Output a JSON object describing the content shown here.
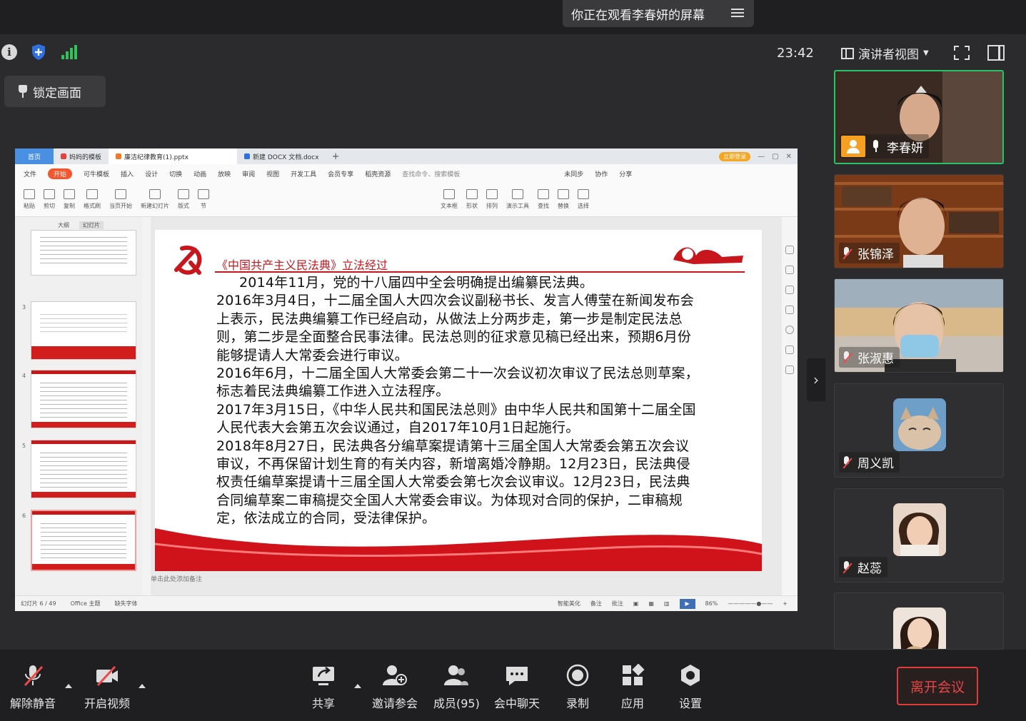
{
  "banner": {
    "share_status": "你正在观看李春妍的屏幕"
  },
  "status_bar": {
    "time": "23:42",
    "view_label": "演讲者视图"
  },
  "lock_button": {
    "label": "锁定画面"
  },
  "wps": {
    "tabs": [
      {
        "label": "首页"
      },
      {
        "label": "妈妈的模板"
      },
      {
        "label": "廉洁纪律教育(1).pptx"
      },
      {
        "label": "新建 DOCX 文档.docx"
      }
    ],
    "upgrade_badge": "立即登录",
    "menu": [
      "文件",
      "开始",
      "可牛模板",
      "插入",
      "设计",
      "切换",
      "动画",
      "放映",
      "审阅",
      "视图",
      "开发工具",
      "会员专享",
      "稻壳资源",
      "查找命令、搜索模板",
      "未同步",
      "协作",
      "分享"
    ],
    "ribbon": [
      "粘贴",
      "剪切",
      "复制",
      "格式刷",
      "当页开始",
      "新建幻灯片",
      "版式",
      "节",
      "文本框",
      "形状",
      "排列",
      "演示工具",
      "查找",
      "替换",
      "选择"
    ],
    "thumb_tabs": [
      "大纲",
      "幻灯片"
    ],
    "thumb_numbers": [
      "3",
      "4",
      "5",
      "6"
    ],
    "slide": {
      "title": "《中国共产主义民法典》立法经过",
      "paragraphs": [
        {
          "text": "2014年11月，党的十八届四中全会明确提出编纂民法典。",
          "indent": true
        },
        {
          "text": "2016年3月4日，十二届全国人大四次会议副秘书长、发言人傅莹在新闻发布会上表示，民法典编纂工作已经启动，从做法上分两步走，第一步是制定民法总则，第二步是全面整合民事法律。民法总则的征求意见稿已经出来，预期6月份能够提请人大常委会进行审议。",
          "indent": false
        },
        {
          "text": "2016年6月，十二届全国人大常委会第二十一次会议初次审议了民法总则草案，标志着民法典编纂工作进入立法程序。",
          "indent": false
        },
        {
          "text": "2017年3月15日，《中华人民共和国民法总则》由中华人民共和国第十二届全国人民代表大会第五次会议通过，自2017年10月1日起施行。",
          "indent": false
        },
        {
          "text": "2018年8月27日，民法典各分编草案提请第十三届全国人大常委会第五次会议审议，不再保留计划生育的有关内容，新增离婚冷静期。12月23日，民法典侵权责任编草案提请十三届全国人大常委会第七次会议审议。12月23日，民法典合同编草案二审稿提交全国人大常委会审议。为体现对合同的保护，二审稿规定，依法成立的合同，受法律保护。",
          "indent": false
        }
      ]
    },
    "notes_placeholder": "单击此处添加备注",
    "status": {
      "slide_count": "幻灯片 6 / 49",
      "theme": "Office 主题",
      "missing_font": "缺失字体",
      "beautify": "智能美化",
      "notes": "备注",
      "comments": "批注",
      "zoom": "86%"
    }
  },
  "participants": [
    {
      "name": "李春妍",
      "speaking": true
    },
    {
      "name": "张锦泽",
      "speaking": false
    },
    {
      "name": "张淑惠",
      "speaking": false
    },
    {
      "name": "周义凯",
      "speaking": false
    },
    {
      "name": "赵蕊",
      "speaking": false
    },
    {
      "name": "",
      "speaking": false
    }
  ],
  "toolbar": {
    "unmute": "解除静音",
    "start_video": "开启视频",
    "share": "共享",
    "invite": "邀请参会",
    "members": "成员(95)",
    "chat": "会中聊天",
    "record": "录制",
    "apps": "应用",
    "settings": "设置",
    "leave": "离开会议"
  },
  "colors": {
    "accent_red": "#c8161d",
    "speaking_border": "#29c267",
    "leave": "#e03c3c"
  }
}
